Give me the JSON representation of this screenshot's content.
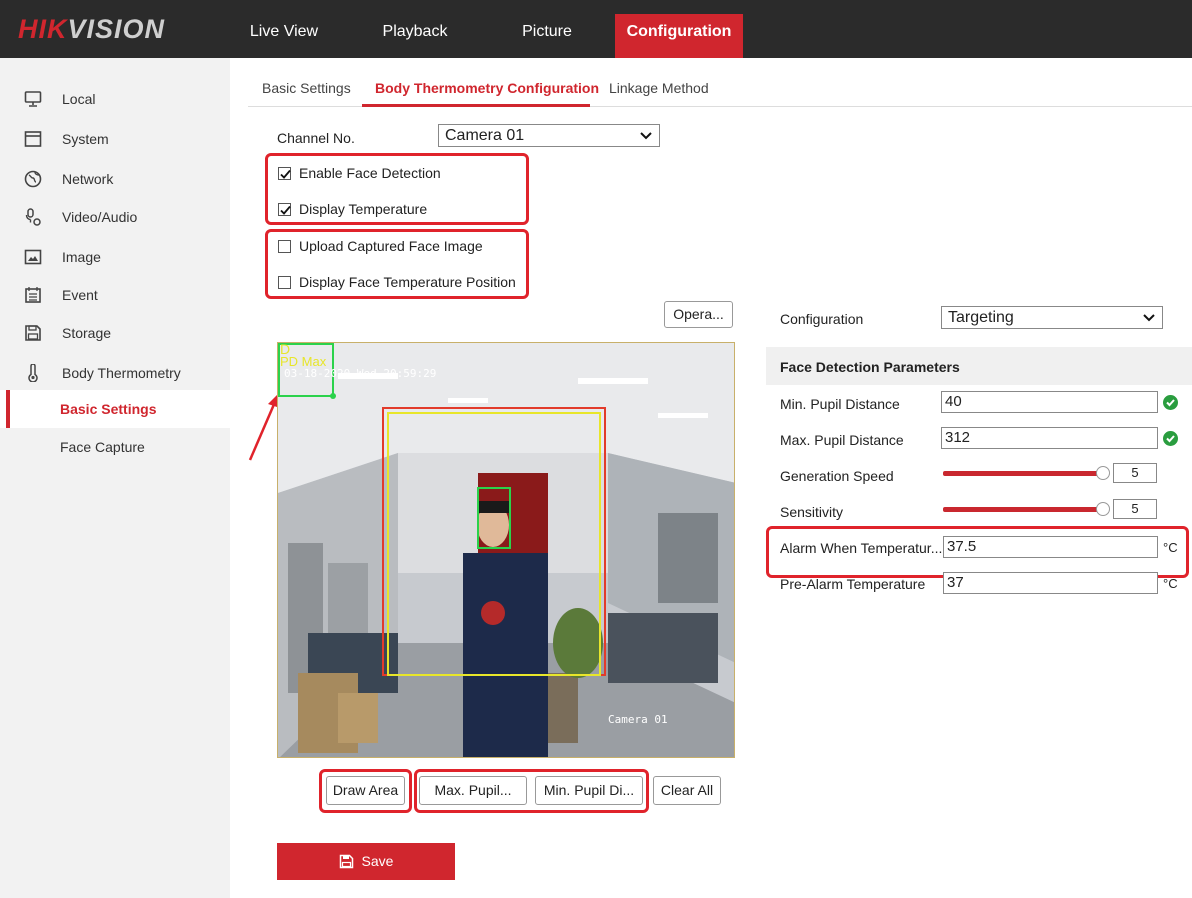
{
  "brand": {
    "hik": "HIK",
    "vision": "VISION"
  },
  "nav": {
    "tabs": [
      {
        "label": "Live View"
      },
      {
        "label": "Playback"
      },
      {
        "label": "Picture"
      },
      {
        "label": "Configuration"
      }
    ],
    "active_tab": "Configuration"
  },
  "sidebar": {
    "items": [
      {
        "label": "Local",
        "icon": "monitor-icon"
      },
      {
        "label": "System",
        "icon": "window-icon"
      },
      {
        "label": "Network",
        "icon": "globe-icon"
      },
      {
        "label": "Video/Audio",
        "icon": "microphone-camera-icon"
      },
      {
        "label": "Image",
        "icon": "image-icon"
      },
      {
        "label": "Event",
        "icon": "calendar-icon"
      },
      {
        "label": "Storage",
        "icon": "floppy-disk-icon"
      },
      {
        "label": "Body Thermometry",
        "icon": "thermometer-icon"
      }
    ],
    "subitems": [
      {
        "label": "Basic Settings"
      },
      {
        "label": "Face Capture"
      }
    ],
    "selected": "Basic Settings"
  },
  "subtabs": {
    "items": [
      {
        "label": "Basic Settings"
      },
      {
        "label": "Body Thermometry Configuration"
      },
      {
        "label": "Linkage Method"
      }
    ],
    "active": "Body Thermometry Configuration"
  },
  "form": {
    "channel_label": "Channel No.",
    "channel_value": "Camera 01",
    "checkboxes": [
      {
        "label": "Enable Face Detection",
        "checked": true
      },
      {
        "label": "Display Temperature",
        "checked": true
      },
      {
        "label": "Upload Captured Face Image",
        "checked": false
      },
      {
        "label": "Display Face Temperature Position",
        "checked": false
      }
    ],
    "opera_button": "Opera..."
  },
  "video": {
    "osd_d": "D",
    "osd_pd_max": "PD Max",
    "timestamp": "03-18-2020 Wed 20:59:29",
    "camera_label": "Camera 01"
  },
  "video_buttons": {
    "draw_area": "Draw Area",
    "max_pupil": "Max. Pupil...",
    "min_pupil": "Min. Pupil Di...",
    "clear_all": "Clear All"
  },
  "right_panel": {
    "configuration_label": "Configuration",
    "configuration_value": "Targeting",
    "section_title": "Face Detection Parameters",
    "min_pupil_label": "Min. Pupil Distance",
    "min_pupil_value": "40",
    "max_pupil_label": "Max. Pupil Distance",
    "max_pupil_value": "312",
    "generation_speed_label": "Generation Speed",
    "generation_speed_value": "5",
    "sensitivity_label": "Sensitivity",
    "sensitivity_value": "5",
    "alarm_label": "Alarm When Temperatur...",
    "alarm_value": "37.5",
    "alarm_unit": "°C",
    "pre_alarm_label": "Pre-Alarm Temperature",
    "pre_alarm_value": "37",
    "pre_alarm_unit": "°C"
  },
  "save_button": "Save",
  "colors": {
    "accent": "#d0262e",
    "topbar": "#2b2b2b",
    "sidebar": "#f2f2f2",
    "ok": "#2a9d3f"
  }
}
